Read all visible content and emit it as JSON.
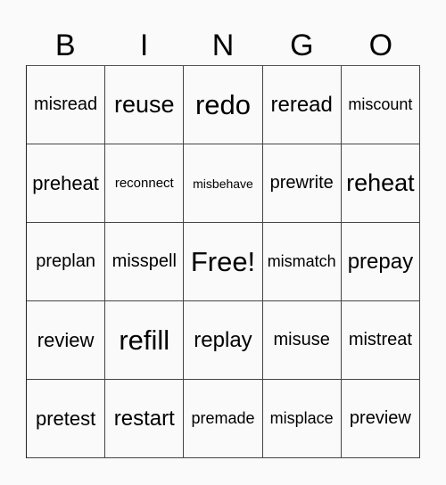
{
  "header": [
    "B",
    "I",
    "N",
    "G",
    "O"
  ],
  "cells": [
    [
      "misread",
      "reuse",
      "redo",
      "reread",
      "miscount"
    ],
    [
      "preheat",
      "reconnect",
      "misbehave",
      "prewrite",
      "reheat"
    ],
    [
      "preplan",
      "misspell",
      "Free!",
      "mismatch",
      "prepay"
    ],
    [
      "review",
      "refill",
      "replay",
      "misuse",
      "mistreat"
    ],
    [
      "pretest",
      "restart",
      "premade",
      "misplace",
      "preview"
    ]
  ]
}
